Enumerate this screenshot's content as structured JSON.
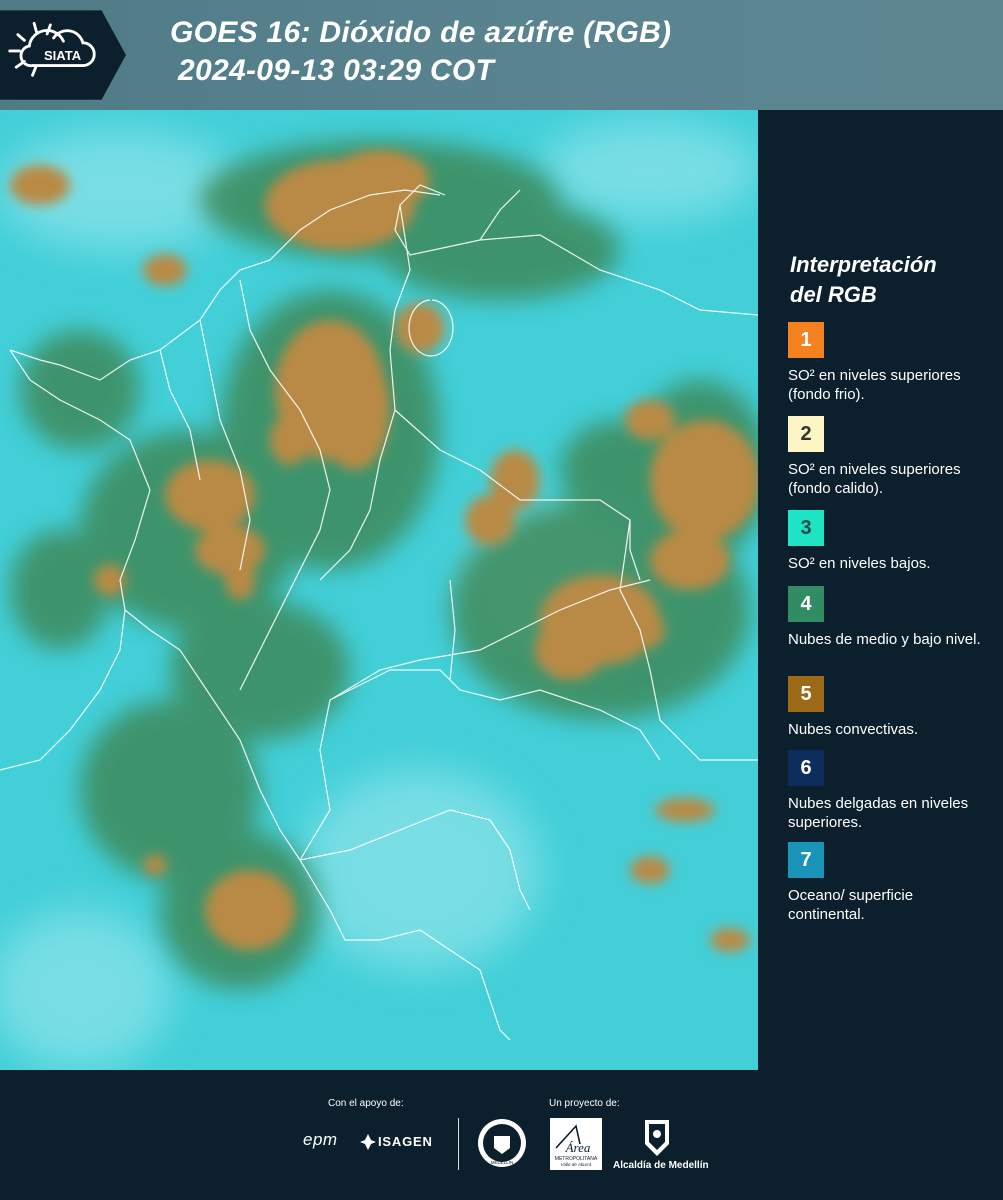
{
  "header": {
    "logo_text": "SIATA",
    "title_line1": "GOES 16: Dióxido de azúfre (RGB)",
    "title_line2": "2024-09-13 03:29 COT"
  },
  "legend": {
    "title_line1": "Interpretación",
    "title_line2": "del RGB",
    "items": [
      {
        "num": "1",
        "color": "#f5821f",
        "text_color": "#ffffff",
        "text": "SO² en niveles superiores (fondo frio)."
      },
      {
        "num": "2",
        "color": "#fdf5c4",
        "text_color": "#333333",
        "text": "SO² en niveles superiores (fondo calido)."
      },
      {
        "num": "3",
        "color": "#1ee3c4",
        "text_color": "#1a4a4a",
        "text": "SO² en niveles bajos."
      },
      {
        "num": "4",
        "color": "#2f8c63",
        "text_color": "#ffffff",
        "text": "Nubes de medio y bajo nivel."
      },
      {
        "num": "5",
        "color": "#9c6a17",
        "text_color": "#ffffff",
        "text": "Nubes convectivas."
      },
      {
        "num": "6",
        "color": "#0d2e5c",
        "text_color": "#ffffff",
        "text": "Nubes delgadas en niveles superiores."
      },
      {
        "num": "7",
        "color": "#1a93b8",
        "text_color": "#ffffff",
        "text": "Oceano/ superficie continental."
      }
    ]
  },
  "footer": {
    "support_label": "Con el apoyo de:",
    "project_label": "Un proyecto de:",
    "epm": "epm",
    "isagen": "ISAGEN",
    "area_name": "Área",
    "area_sub1": "METROPOLITANA",
    "area_sub2": "Valle de Aburrá",
    "alcaldia": "Alcaldía de Medellín",
    "seal_text": "MEDELLÍN"
  },
  "colors": {
    "header_bg": "#52808b",
    "sidebar_bg": "#0c1f2c",
    "map_base": "#3fd0d6",
    "cloud": "#b98a45",
    "cloud_green": "#3e8a5a"
  }
}
